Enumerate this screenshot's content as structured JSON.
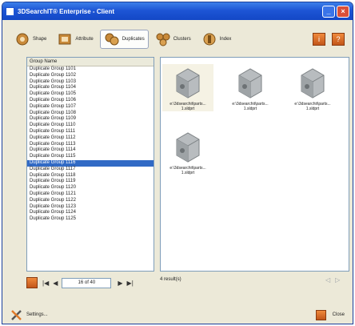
{
  "window": {
    "title": "3DSearchIT® Enterprise - Client"
  },
  "toolbar": {
    "tabs": [
      {
        "label": "Shape",
        "icon": "shape-gears-icon"
      },
      {
        "label": "Attribute",
        "icon": "attribute-icon"
      },
      {
        "label": "Duplicates",
        "icon": "duplicates-icon"
      },
      {
        "label": "Clusters",
        "icon": "clusters-icon"
      },
      {
        "label": "Index",
        "icon": "index-icon"
      }
    ],
    "active_tab": "Duplicates",
    "right_buttons": [
      "info-icon",
      "help-icon"
    ]
  },
  "group_list": {
    "header": "Group Name",
    "items": [
      "Duplicate Group 1101",
      "Duplicate Group 1102",
      "Duplicate Group 1103",
      "Duplicate Group 1104",
      "Duplicate Group 1105",
      "Duplicate Group 1106",
      "Duplicate Group 1107",
      "Duplicate Group 1108",
      "Duplicate Group 1109",
      "Duplicate Group 1110",
      "Duplicate Group 1111",
      "Duplicate Group 1112",
      "Duplicate Group 1113",
      "Duplicate Group 1114",
      "Duplicate Group 1115",
      "Duplicate Group 1116",
      "Duplicate Group 1117",
      "Duplicate Group 1118",
      "Duplicate Group 1119",
      "Duplicate Group 1120",
      "Duplicate Group 1121",
      "Duplicate Group 1122",
      "Duplicate Group 1123",
      "Duplicate Group 1124",
      "Duplicate Group 1125"
    ],
    "selected": "Duplicate Group 1116"
  },
  "results": {
    "files": [
      {
        "name": "e:\\3dsearchit\\parts...\n1.sldprt"
      },
      {
        "name": "e:\\3dsearchit\\parts...\n1.sldprt"
      },
      {
        "name": "e:\\3dsearchit\\parts...\n1.sldprt"
      },
      {
        "name": "e:\\3dsearchit\\parts...\n1.sldprt"
      }
    ],
    "status": "4 result(s)"
  },
  "pager": {
    "first": "|◀",
    "prev": "◀",
    "page_text": "16 of 40",
    "next": "▶",
    "last": "▶|"
  },
  "result_nav": {
    "prev": "◁",
    "next": "▷"
  },
  "footer": {
    "settings_label": "Settings...",
    "close_label": "Close"
  },
  "colors": {
    "title_bar": "#1d55d5",
    "selection": "#316ac5",
    "accent_orange": "#e07a2a"
  }
}
